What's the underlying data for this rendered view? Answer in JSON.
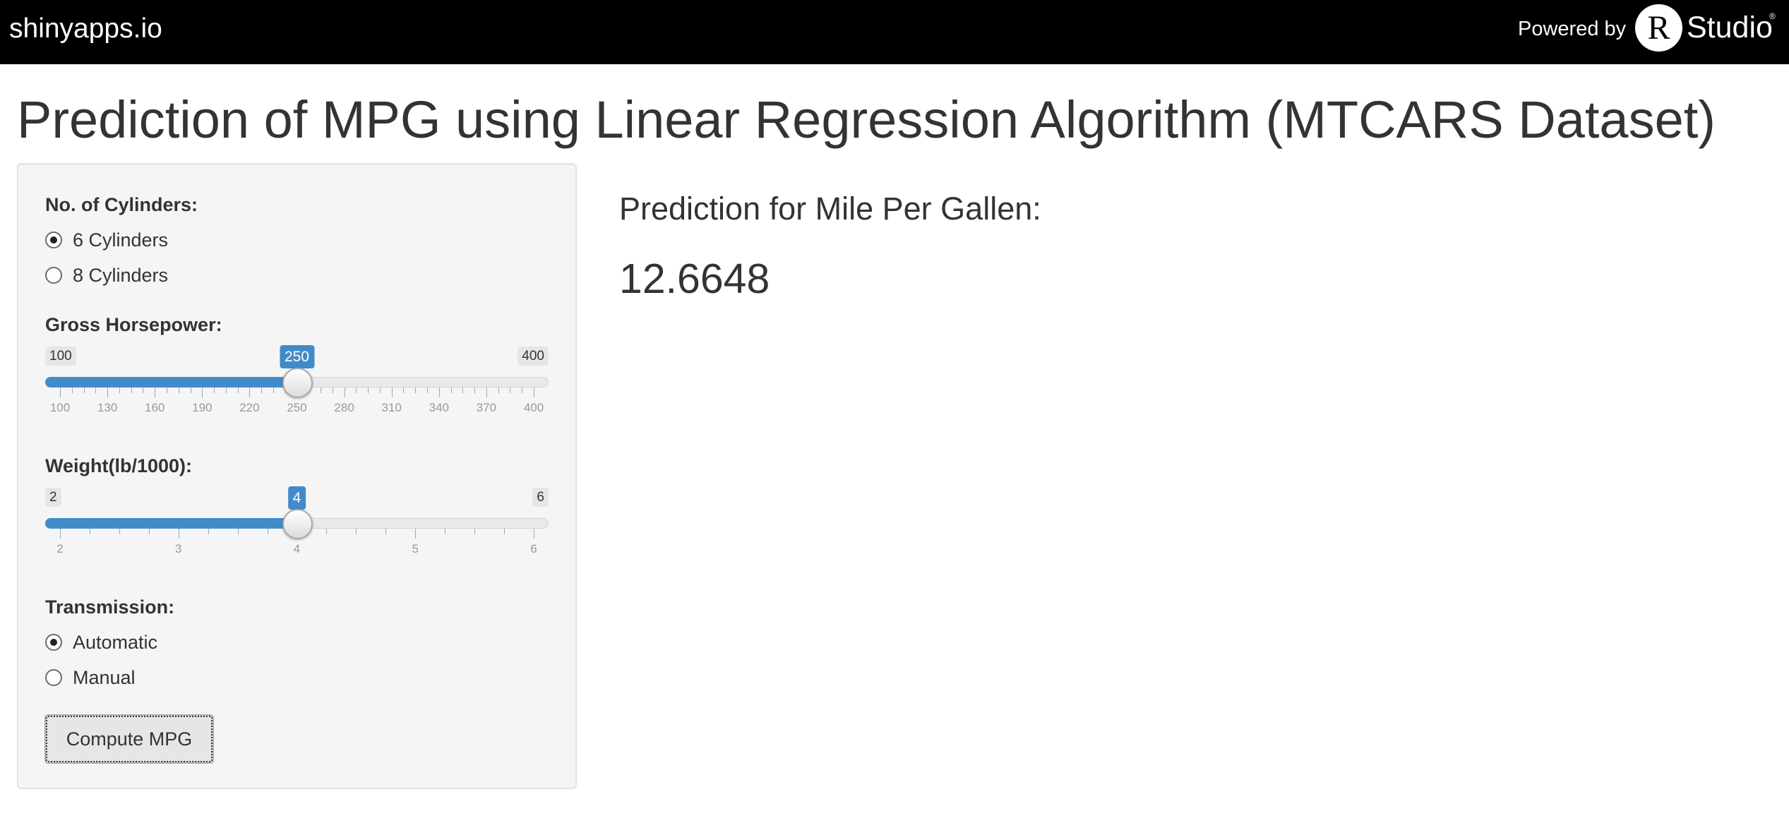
{
  "header": {
    "brand": "shinyapps.io",
    "powered_by": "Powered by",
    "logo_letter": "R",
    "logo_text": "Studio",
    "logo_mark": "®"
  },
  "title": "Prediction of MPG using Linear Regression Algorithm (MTCARS Dataset)",
  "sidebar": {
    "cylinders": {
      "label": "No. of Cylinders:",
      "options": [
        "6 Cylinders",
        "8 Cylinders"
      ],
      "selected": "6 Cylinders"
    },
    "horsepower": {
      "label": "Gross Horsepower:",
      "min": 100,
      "max": 400,
      "value": 250,
      "grid_labels": [
        "100",
        "130",
        "160",
        "190",
        "220",
        "250",
        "280",
        "310",
        "340",
        "370",
        "400"
      ]
    },
    "weight": {
      "label": "Weight(lb/1000):",
      "min": 2,
      "max": 6,
      "value": 4,
      "grid_labels": [
        "2",
        "3",
        "4",
        "5",
        "6"
      ]
    },
    "transmission": {
      "label": "Transmission:",
      "options": [
        "Automatic",
        "Manual"
      ],
      "selected": "Automatic"
    },
    "compute_button": "Compute MPG"
  },
  "main": {
    "prediction_heading": "Prediction for Mile Per Gallen:",
    "prediction_value": "12.6648"
  },
  "colors": {
    "accent": "#428bca",
    "topbar": "#000000",
    "well": "#f5f5f5"
  }
}
